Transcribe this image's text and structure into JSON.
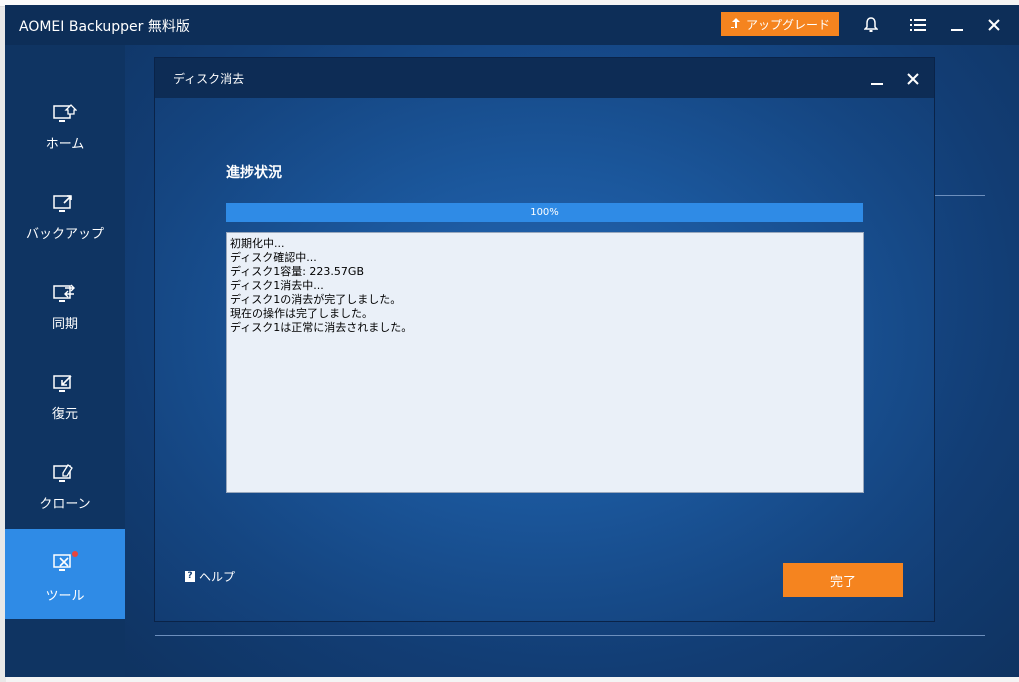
{
  "app": {
    "title": "AOMEI Backupper 無料版",
    "upgrade_label": "アップグレード",
    "icons": [
      "upload-arrow-icon",
      "bell-icon",
      "menu-icon",
      "minimize-icon",
      "close-icon"
    ]
  },
  "sidebar": {
    "items": [
      {
        "label": "ホーム",
        "icon": "home-monitor-icon"
      },
      {
        "label": "バックアップ",
        "icon": "backup-monitor-icon"
      },
      {
        "label": "同期",
        "icon": "sync-monitor-icon"
      },
      {
        "label": "復元",
        "icon": "restore-monitor-icon"
      },
      {
        "label": "クローン",
        "icon": "clone-monitor-icon"
      },
      {
        "label": "ツール",
        "icon": "tools-monitor-icon",
        "active": true
      }
    ]
  },
  "dialog": {
    "title": "ディスク消去",
    "section_title": "進捗状況",
    "progress": {
      "value": 100,
      "text": "100%"
    },
    "log_lines": [
      "初期化中...",
      "ディスク確認中...",
      "ディスク1容量: 223.57GB",
      "ディスク1消去中...",
      "ディスク1の消去が完了しました。",
      "現在の操作は完了しました。",
      "ディスク1は正常に消去されました。"
    ],
    "help_label": "ヘルプ",
    "done_label": "完了"
  },
  "colors": {
    "accent_orange": "#f5841f",
    "active_blue": "#2f8be6",
    "sidebar_bg": "#0f3462",
    "titlebar_bg": "#0d2e58"
  }
}
